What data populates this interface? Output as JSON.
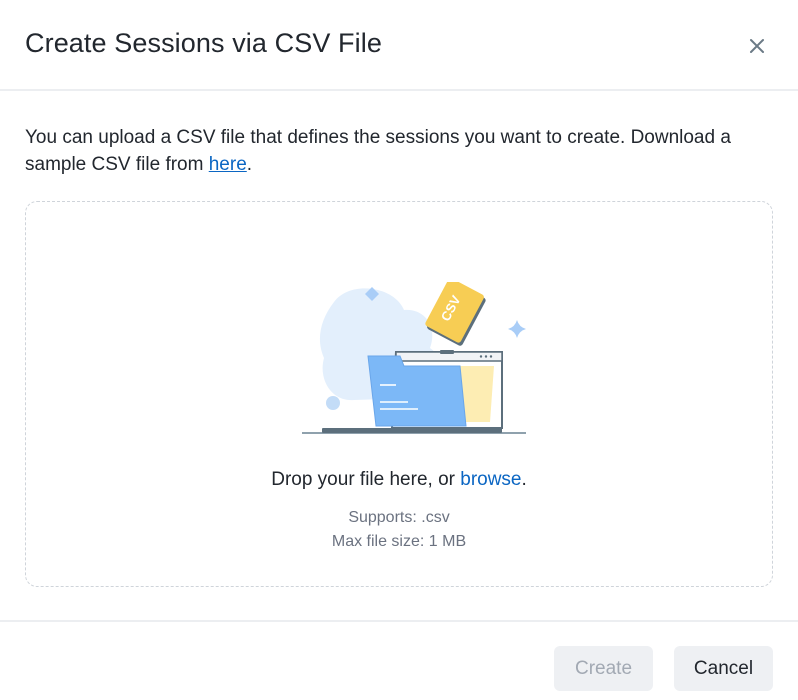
{
  "dialog": {
    "title": "Create Sessions via CSV File",
    "close_icon": "close-icon"
  },
  "intro": {
    "text_before": "You can upload a CSV file that defines the sessions you want to create. Download a sample CSV file from ",
    "link_text": "here",
    "text_after": "."
  },
  "dropzone": {
    "illustration_label": "CSV",
    "text_before": "Drop your file here, or ",
    "browse_text": "browse",
    "text_after": ".",
    "supports": "Supports: .csv",
    "max_size": "Max file size: 1 MB"
  },
  "footer": {
    "create_label": "Create",
    "cancel_label": "Cancel",
    "create_disabled": true
  },
  "colors": {
    "link": "#0b66c3",
    "folder_blue": "#7cb8f7",
    "paper_yellow": "#f7cd54",
    "disabled_text": "#a2a9b3"
  }
}
